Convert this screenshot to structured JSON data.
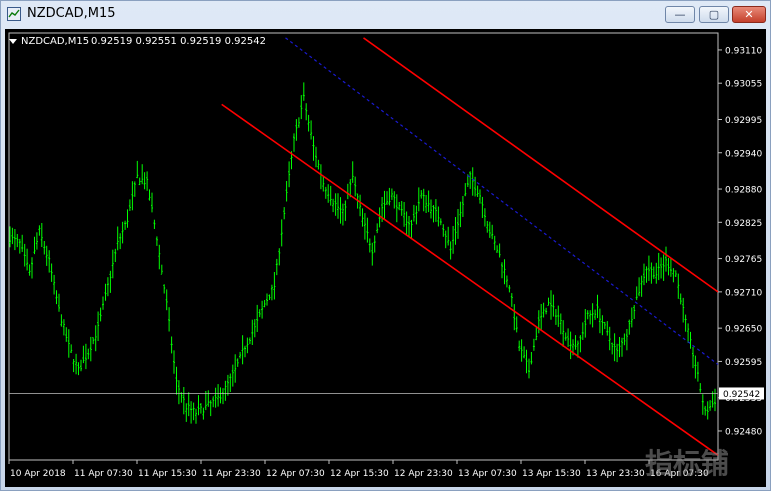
{
  "window": {
    "title": "NZDCAD,M15",
    "controls": {
      "minimize": "—",
      "maximize": "▢",
      "close": "✕"
    }
  },
  "chart": {
    "symbol_label": "NZDCAD,M15",
    "ohlc_label": "0.92519 0.92551 0.92519 0.92542",
    "current_price_label": "0.92542",
    "watermark": "指标铺",
    "colors": {
      "background": "#000000",
      "bars": "#00ff00",
      "channel": "#ff0000",
      "midline": "#1a1ad0",
      "text": "#ffffff",
      "price_line": "#c0c0c0"
    }
  },
  "chart_data": {
    "type": "ohlc",
    "yticks": [
      "0.93110",
      "0.93055",
      "0.92995",
      "0.92940",
      "0.92880",
      "0.92825",
      "0.92765",
      "0.92710",
      "0.92650",
      "0.92595",
      "0.92535",
      "0.92480"
    ],
    "ytick_values": [
      0.9311,
      0.93055,
      0.92995,
      0.9294,
      0.9288,
      0.92825,
      0.92765,
      0.9271,
      0.9265,
      0.92595,
      0.92535,
      0.9248
    ],
    "xticks": [
      "10 Apr 2018",
      "11 Apr 07:30",
      "11 Apr 15:30",
      "11 Apr 23:30",
      "12 Apr 07:30",
      "12 Apr 15:30",
      "12 Apr 23:30",
      "13 Apr 07:30",
      "13 Apr 15:30",
      "13 Apr 23:30",
      "16 Apr 07:30"
    ],
    "ylim": [
      0.92432,
      0.93138
    ],
    "current_price": 0.92542,
    "series_anchors": [
      [
        0,
        0.928
      ],
      [
        4,
        0.9279
      ],
      [
        8,
        0.9274
      ],
      [
        12,
        0.9281
      ],
      [
        16,
        0.9276
      ],
      [
        20,
        0.9268
      ],
      [
        24,
        0.9262
      ],
      [
        28,
        0.9258
      ],
      [
        32,
        0.9261
      ],
      [
        36,
        0.9265
      ],
      [
        40,
        0.9272
      ],
      [
        44,
        0.9279
      ],
      [
        48,
        0.9283
      ],
      [
        52,
        0.929
      ],
      [
        56,
        0.9289
      ],
      [
        60,
        0.928
      ],
      [
        64,
        0.9269
      ],
      [
        68,
        0.9256
      ],
      [
        72,
        0.9252
      ],
      [
        76,
        0.9251
      ],
      [
        80,
        0.9252
      ],
      [
        84,
        0.9253
      ],
      [
        88,
        0.9255
      ],
      [
        92,
        0.9258
      ],
      [
        96,
        0.9262
      ],
      [
        100,
        0.9265
      ],
      [
        104,
        0.9269
      ],
      [
        108,
        0.9272
      ],
      [
        112,
        0.9284
      ],
      [
        116,
        0.9296
      ],
      [
        120,
        0.9303
      ],
      [
        124,
        0.9295
      ],
      [
        128,
        0.9289
      ],
      [
        132,
        0.9286
      ],
      [
        136,
        0.9284
      ],
      [
        140,
        0.929
      ],
      [
        144,
        0.9283
      ],
      [
        148,
        0.9278
      ],
      [
        152,
        0.9285
      ],
      [
        156,
        0.9287
      ],
      [
        160,
        0.9284
      ],
      [
        164,
        0.9282
      ],
      [
        168,
        0.9287
      ],
      [
        172,
        0.9285
      ],
      [
        176,
        0.9283
      ],
      [
        180,
        0.9278
      ],
      [
        184,
        0.9284
      ],
      [
        188,
        0.929
      ],
      [
        192,
        0.9287
      ],
      [
        196,
        0.9281
      ],
      [
        200,
        0.9277
      ],
      [
        204,
        0.9272
      ],
      [
        208,
        0.9262
      ],
      [
        212,
        0.9258
      ],
      [
        216,
        0.9266
      ],
      [
        220,
        0.9269
      ],
      [
        224,
        0.9267
      ],
      [
        228,
        0.9263
      ],
      [
        232,
        0.9262
      ],
      [
        236,
        0.9267
      ],
      [
        240,
        0.9268
      ],
      [
        244,
        0.9264
      ],
      [
        248,
        0.9261
      ],
      [
        252,
        0.9264
      ],
      [
        256,
        0.927
      ],
      [
        260,
        0.9275
      ],
      [
        264,
        0.9274
      ],
      [
        268,
        0.9276
      ],
      [
        272,
        0.9274
      ],
      [
        276,
        0.9266
      ],
      [
        280,
        0.9259
      ],
      [
        284,
        0.9251
      ],
      [
        288,
        0.9253
      ]
    ],
    "channel": {
      "upper": [
        [
          0.5,
          0.9313
        ],
        [
          1.0,
          0.9271
        ]
      ],
      "lower": [
        [
          0.3,
          0.9302
        ],
        [
          1.0,
          0.9244
        ]
      ],
      "mid": [
        [
          0.39,
          0.9313
        ],
        [
          1.0,
          0.9259
        ]
      ]
    }
  }
}
